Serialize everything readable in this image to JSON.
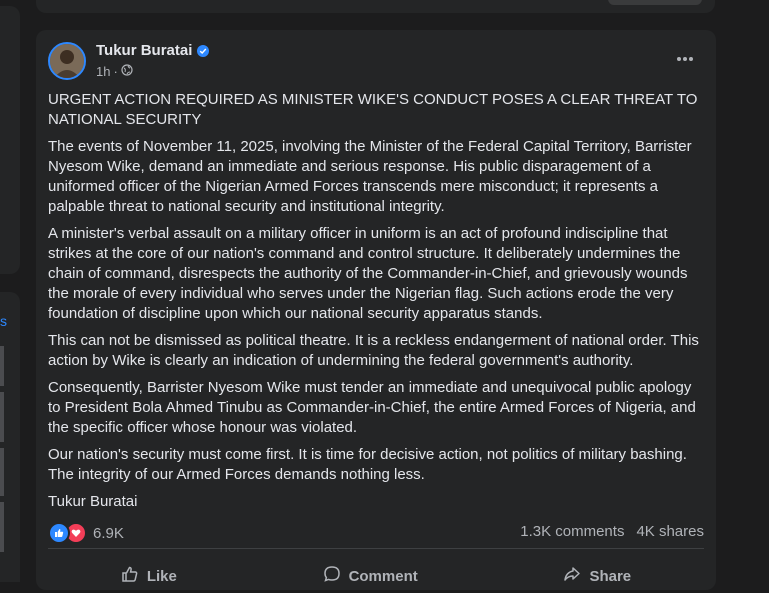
{
  "left_sidebar": {
    "link_fragment": "s"
  },
  "post": {
    "author": "Tukur Buratai",
    "time": "1h",
    "meta_separator": "·",
    "paragraphs": [
      "URGENT ACTION REQUIRED AS MINISTER WIKE'S CONDUCT POSES A CLEAR THREAT TO NATIONAL SECURITY",
      "The events of November 11, 2025, involving the Minister of the Federal Capital Territory, Barrister Nyesom Wike, demand an immediate and serious response. His public disparagement of a uniformed officer of the Nigerian Armed Forces transcends mere misconduct; it represents a palpable threat to national security and institutional integrity.",
      "A minister's verbal assault on a military officer in uniform is an act of profound indiscipline that strikes at the core of our nation's command and control structure. It deliberately undermines the chain of command, disrespects the authority of the Commander-in-Chief, and grievously wounds the morale of every individual who serves under the Nigerian flag. Such actions erode the very foundation of discipline upon which our national security apparatus stands.",
      "This can not be dismissed as political theatre. It is a reckless endangerment of national order. This action by Wike is clearly an indication of undermining  the federal government's authority.",
      "Consequently, Barrister Nyesom Wike must tender an immediate and unequivocal public apology to President Bola Ahmed Tinubu as Commander-in-Chief, the entire Armed Forces of Nigeria, and the specific officer whose honour was violated.",
      "Our nation's security must come first. It is time for decisive action, not politics of military bashing. The integrity of our Armed Forces demands nothing less.",
      "Tukur Buratai"
    ],
    "reaction_count": "6.9K",
    "comments": "1.3K comments",
    "shares": "4K shares",
    "actions": {
      "like": "Like",
      "comment": "Comment",
      "share": "Share"
    }
  },
  "colors": {
    "background": "#1c1c1d",
    "card": "#242526",
    "accent": "#2d88ff",
    "text": "#e4e6eb",
    "secondary": "#b0b3b8",
    "love": "#f33e58"
  }
}
